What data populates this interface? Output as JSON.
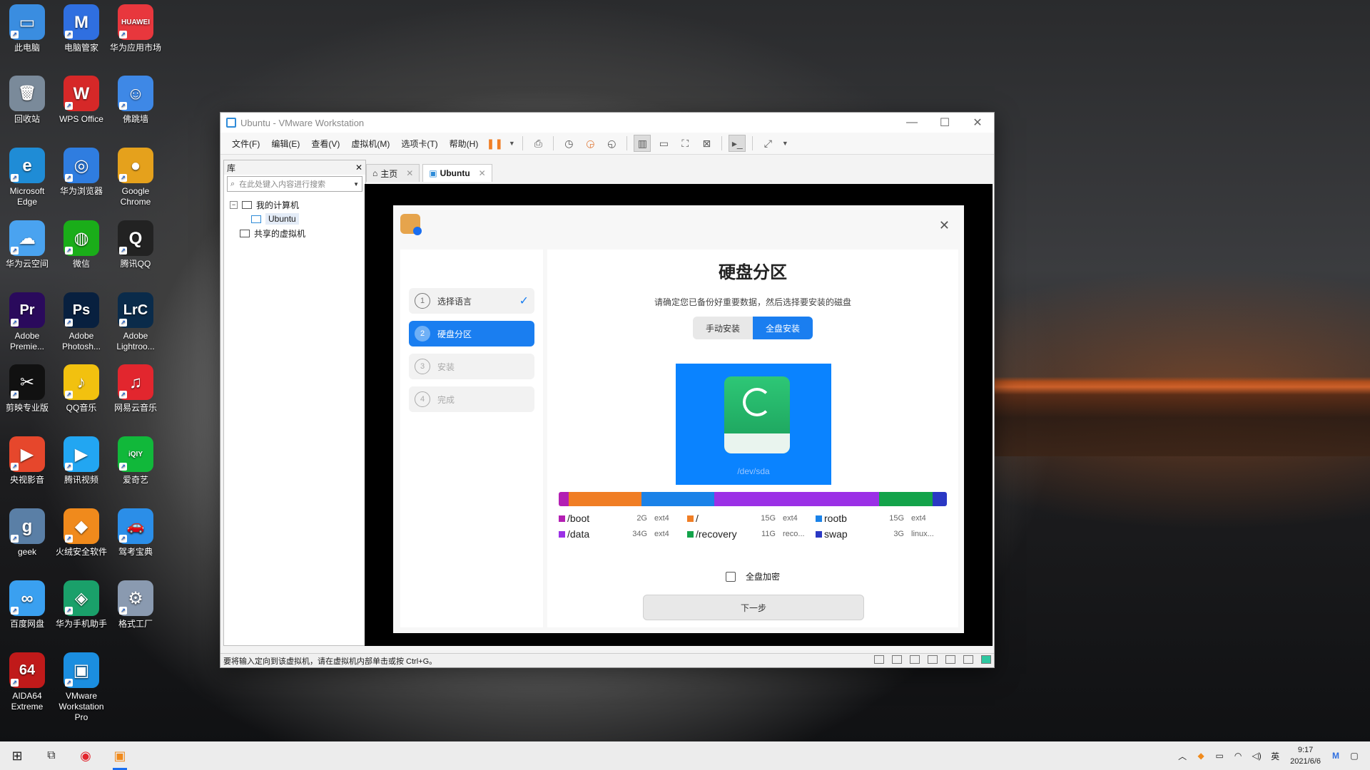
{
  "desktop_icons": [
    {
      "label": "此电脑",
      "color": "#3a8de0",
      "glyph": "▭"
    },
    {
      "label": "电脑管家",
      "color": "#2f6fe0",
      "glyph": "M"
    },
    {
      "label": "华为应用市场",
      "color": "#e8373d",
      "glyph": "HUAWEI"
    },
    {
      "label": "回收站",
      "color": "#7a8a9a",
      "glyph": "🗑"
    },
    {
      "label": "WPS Office",
      "color": "#d62828",
      "glyph": "W"
    },
    {
      "label": "佛跳墙",
      "color": "#3e88e6",
      "glyph": "☺"
    },
    {
      "label": "Microsoft Edge",
      "color": "#1f8cd6",
      "glyph": "e"
    },
    {
      "label": "华为浏览器",
      "color": "#2f7de0",
      "glyph": "◎"
    },
    {
      "label": "Google Chrome",
      "color": "#e5a11c",
      "glyph": "●"
    },
    {
      "label": "华为云空间",
      "color": "#4aa3f0",
      "glyph": "☁"
    },
    {
      "label": "微信",
      "color": "#1aad19",
      "glyph": "◍"
    },
    {
      "label": "腾讯QQ",
      "color": "#222222",
      "glyph": "Q"
    },
    {
      "label": "Adobe Premie...",
      "color": "#2a0a5c",
      "glyph": "Pr"
    },
    {
      "label": "Adobe Photosh...",
      "color": "#08203f",
      "glyph": "Ps"
    },
    {
      "label": "Adobe Lightroo...",
      "color": "#0a2b4a",
      "glyph": "LrC"
    },
    {
      "label": "剪映专业版",
      "color": "#111111",
      "glyph": "✂"
    },
    {
      "label": "QQ音乐",
      "color": "#f2c10f",
      "glyph": "♪"
    },
    {
      "label": "网易云音乐",
      "color": "#e2262e",
      "glyph": "♫"
    },
    {
      "label": "央视影音",
      "color": "#e6472c",
      "glyph": "▶"
    },
    {
      "label": "腾讯视频",
      "color": "#22a6f2",
      "glyph": "▶"
    },
    {
      "label": "爱奇艺",
      "color": "#11b83a",
      "glyph": "iQIY"
    },
    {
      "label": "geek",
      "color": "#5a7fa6",
      "glyph": "g"
    },
    {
      "label": "火绒安全软件",
      "color": "#f08a1c",
      "glyph": "◆"
    },
    {
      "label": "驾考宝典",
      "color": "#2b8ee8",
      "glyph": "🚗"
    },
    {
      "label": "百度网盘",
      "color": "#3aa0f0",
      "glyph": "∞"
    },
    {
      "label": "华为手机助手",
      "color": "#1aa06a",
      "glyph": "◈"
    },
    {
      "label": "格式工厂",
      "color": "#8a9ab0",
      "glyph": "⚙"
    },
    {
      "label": "AIDA64 Extreme",
      "color": "#c01a1a",
      "glyph": "64"
    },
    {
      "label": "VMware Workstation Pro",
      "color": "#1b8ee0",
      "glyph": "▣"
    }
  ],
  "window": {
    "title": "Ubuntu - VMware Workstation",
    "menu": [
      "文件(F)",
      "编辑(E)",
      "查看(V)",
      "虚拟机(M)",
      "选项卡(T)",
      "帮助(H)"
    ],
    "library": {
      "title": "库",
      "search_placeholder": "在此处键入内容进行搜索",
      "tree": {
        "my_computer": "我的计算机",
        "vm": "Ubuntu",
        "shared": "共享的虚拟机"
      }
    },
    "tabs": [
      {
        "label": "主页"
      },
      {
        "label": "Ubuntu"
      }
    ],
    "status_text": "要将输入定向到该虚拟机，请在虚拟机内部单击或按 Ctrl+G。"
  },
  "installer": {
    "steps": [
      {
        "num": "1",
        "label": "选择语言",
        "state": "done"
      },
      {
        "num": "2",
        "label": "硬盘分区",
        "state": "active"
      },
      {
        "num": "3",
        "label": "安装",
        "state": "pending"
      },
      {
        "num": "4",
        "label": "完成",
        "state": "pending"
      }
    ],
    "title": "硬盘分区",
    "subtitle": "请确定您已备份好重要数据，然后选择要安装的磁盘",
    "mode_manual": "手动安装",
    "mode_full": "全盘安装",
    "disk_label": "/dev/sda",
    "partition_bar": [
      {
        "color": "#b31fb3",
        "share": 2
      },
      {
        "color": "#f07e25",
        "share": 15
      },
      {
        "color": "#1a82e8",
        "share": 15
      },
      {
        "color": "#9b30e6",
        "share": 34
      },
      {
        "color": "#13a34a",
        "share": 11
      },
      {
        "color": "#2a38c4",
        "share": 3
      }
    ],
    "partitions": [
      {
        "name": "/boot",
        "size": "2G",
        "fs": "ext4",
        "color": "#b31fb3"
      },
      {
        "name": "/",
        "size": "15G",
        "fs": "ext4",
        "color": "#f07e25"
      },
      {
        "name": "rootb",
        "size": "15G",
        "fs": "ext4",
        "color": "#1a82e8"
      },
      {
        "name": "/data",
        "size": "34G",
        "fs": "ext4",
        "color": "#9b30e6"
      },
      {
        "name": "/recovery",
        "size": "11G",
        "fs": "reco...",
        "color": "#13a34a"
      },
      {
        "name": "swap",
        "size": "3G",
        "fs": "linux...",
        "color": "#2a38c4"
      }
    ],
    "encrypt_label": "全盘加密",
    "next_label": "下一步"
  },
  "taskbar": {
    "time": "9:17",
    "date": "2021/6/6",
    "ime": "英"
  }
}
